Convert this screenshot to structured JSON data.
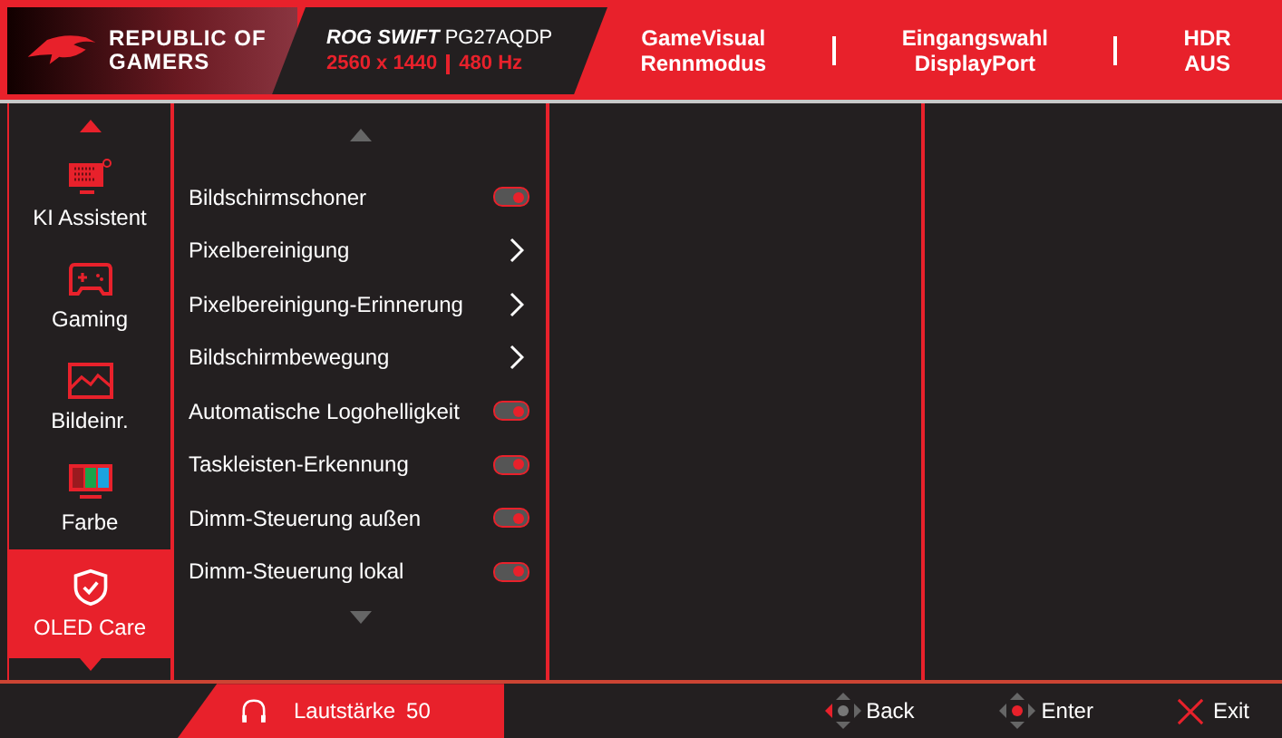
{
  "header": {
    "brand": [
      "REPUBLIC OF",
      "GAMERS"
    ],
    "model_name": "ROG SWIFT",
    "model_code": "PG27AQDP",
    "resolution": "2560 x 1440",
    "refresh": "480 Hz",
    "status": [
      {
        "label": "GameVisual",
        "value": "Rennmodus"
      },
      {
        "label": "Eingangswahl",
        "value": "DisplayPort"
      },
      {
        "label": "HDR",
        "value": "AUS"
      }
    ]
  },
  "sidebar": {
    "items": [
      {
        "kind": "ai",
        "label": "KI Assistent",
        "selected": false
      },
      {
        "kind": "gaming",
        "label": "Gaming",
        "selected": false
      },
      {
        "kind": "image",
        "label": "Bildeinr.",
        "selected": false
      },
      {
        "kind": "color",
        "label": "Farbe",
        "selected": false
      },
      {
        "kind": "oled",
        "label": "OLED Care",
        "selected": true
      }
    ]
  },
  "menu": {
    "items": [
      {
        "label": "Bildschirmschoner",
        "kind": "toggle",
        "on": true
      },
      {
        "label": "Pixelbereinigung",
        "kind": "submenu"
      },
      {
        "label": "Pixelbereinigung-Erinnerung",
        "kind": "submenu"
      },
      {
        "label": "Bildschirmbewegung",
        "kind": "submenu"
      },
      {
        "label": "Automatische Logohelligkeit",
        "kind": "toggle",
        "on": true
      },
      {
        "label": "Taskleisten-Erkennung",
        "kind": "toggle",
        "on": true
      },
      {
        "label": "Dimm-Steuerung außen",
        "kind": "toggle",
        "on": true
      },
      {
        "label": "Dimm-Steuerung lokal",
        "kind": "toggle",
        "on": true
      }
    ]
  },
  "footer": {
    "volume_label": "Lautstärke",
    "volume_value": "50",
    "hints": [
      {
        "kind": "back",
        "label": "Back"
      },
      {
        "kind": "enter",
        "label": "Enter"
      },
      {
        "kind": "exit",
        "label": "Exit"
      }
    ]
  }
}
